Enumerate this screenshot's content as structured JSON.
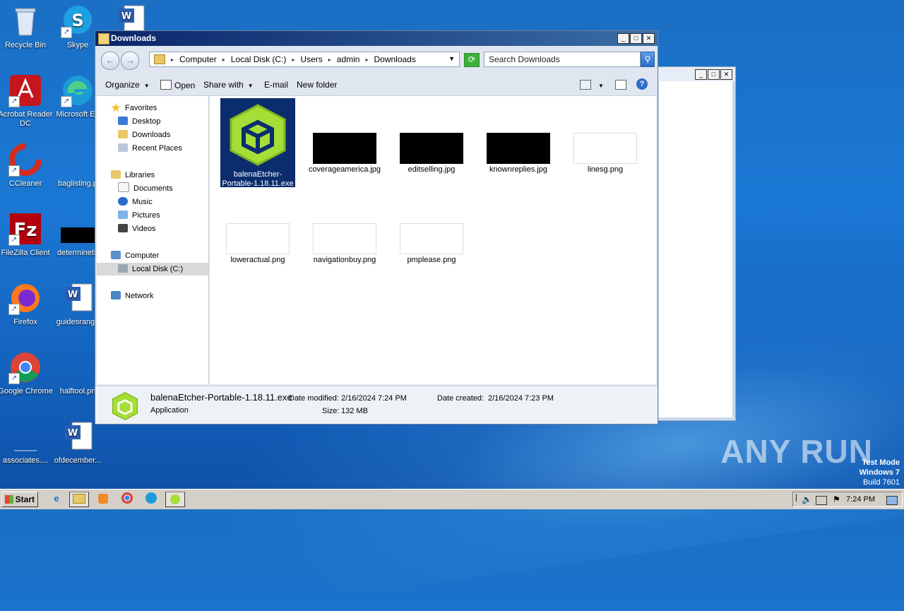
{
  "desktop": {
    "icons": [
      {
        "label": "Recycle Bin"
      },
      {
        "label": "Skype"
      },
      {
        "label": "Acrobat Reader DC"
      },
      {
        "label": "Microsoft Ed"
      },
      {
        "label": "CCleaner"
      },
      {
        "label": "baglisting.p"
      },
      {
        "label": "FileZilla Client"
      },
      {
        "label": "determineth"
      },
      {
        "label": "Firefox"
      },
      {
        "label": "guidesrange"
      },
      {
        "label": "Google Chrome"
      },
      {
        "label": "halftool.pn"
      },
      {
        "label": "associates...."
      },
      {
        "label": "ofdecember..."
      }
    ]
  },
  "window": {
    "title": "Downloads",
    "breadcrumbs": [
      "Computer",
      "Local Disk (C:)",
      "Users",
      "admin",
      "Downloads"
    ],
    "search_placeholder": "Search Downloads",
    "toolbar": {
      "organize": "Organize",
      "open": "Open",
      "share_with": "Share with",
      "email": "E-mail",
      "new_folder": "New folder"
    },
    "nav": {
      "favorites": "Favorites",
      "desktop": "Desktop",
      "downloads": "Downloads",
      "recent_places": "Recent Places",
      "libraries": "Libraries",
      "documents": "Documents",
      "music": "Music",
      "pictures": "Pictures",
      "videos": "Videos",
      "computer": "Computer",
      "local_disk": "Local Disk (C:)",
      "network": "Network"
    },
    "files": [
      {
        "name": "balenaEtcher-Portable-1.18.11.exe"
      },
      {
        "name": "coverageamerica.jpg"
      },
      {
        "name": "editselling.jpg"
      },
      {
        "name": "knownreplies.jpg"
      },
      {
        "name": "linesg.png"
      },
      {
        "name": "loweractual.png"
      },
      {
        "name": "navigationbuy.png"
      },
      {
        "name": "pmplease.png"
      }
    ],
    "details": {
      "filename": "balenaEtcher-Portable-1.18.11.exe",
      "type": "Application",
      "date_modified_label": "Date modified:",
      "date_modified": "2/16/2024 7:24 PM",
      "date_created_label": "Date created:",
      "date_created": "2/16/2024 7:23 PM",
      "size_label": "Size:",
      "size": "132 MB"
    }
  },
  "taskbar": {
    "start": "Start",
    "clock": "7:24 PM"
  },
  "watermark": "ANY RUN",
  "test_mode": {
    "line1": "Test Mode",
    "line2": "Windows 7",
    "line3": "Build 7601"
  }
}
